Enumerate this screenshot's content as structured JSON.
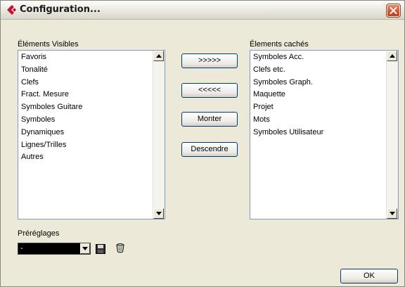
{
  "window": {
    "title": "Configuration..."
  },
  "visible_list": {
    "label": "Éléments Visibles",
    "items": [
      "Favoris",
      "Tonalité",
      "Clefs",
      "Fract. Mesure",
      "Symboles Guitare",
      "Symboles",
      "Dynamiques",
      "Lignes/Trilles",
      "Autres"
    ]
  },
  "hidden_list": {
    "label": "Élements cachés",
    "items": [
      "Symboles Acc.",
      "Clefs etc.",
      "Symboles Graph.",
      "Maquette",
      "Projet",
      "Mots",
      "Symboles Utilisateur"
    ]
  },
  "buttons": {
    "move_right": ">>>>>",
    "move_left": "<<<<<",
    "up": "Monter",
    "down": "Descendre",
    "ok": "OK"
  },
  "presets": {
    "label": "Préréglages",
    "value": "-"
  },
  "icons": {
    "app": "cubase-icon",
    "close": "close-icon",
    "save": "save-icon",
    "delete": "trash-icon",
    "close_color": "#d6512d",
    "app_color": "#c8102e"
  }
}
